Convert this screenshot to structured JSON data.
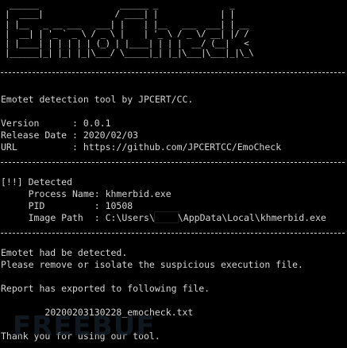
{
  "banner_ascii": "  ______                 ______ _               _\n |  ____|               / ____| |             | |\n | |__   _ __ ___   ___| |    | |__   ___  ___| | __\n |  __| | '_ ` _ \\ / _ \\ |    | '_ \\ / _ \\/ __| |/ /\n | |____| | | | | | (_) | |____| | | |  __/ (__|   <\n |______|_| |_| |_|\\___/ \\_____|_| |_|\\___|\\___|_|\\_\\",
  "intro": "Emotet detection tool by JPCERT/CC.",
  "version": {
    "label": "Version      ",
    "sep": ": ",
    "value": "0.0.1"
  },
  "release": {
    "label": "Release Date ",
    "sep": ": ",
    "value": "2020/02/03"
  },
  "url": {
    "label": "URL          ",
    "sep": ": ",
    "value": "https://github.com/JPCERTCC/EmoCheck"
  },
  "detected": {
    "header": "[!!] Detected",
    "process_label": "Process Name: ",
    "process_name": "khmerbid.exe",
    "pid_label": "PID         : ",
    "pid": "10508",
    "path_label": "Image Path  : ",
    "path_prefix": "C:\\Users\\",
    "path_suffix": "\\AppData\\Local\\khmerbid.exe"
  },
  "result_line1": "Emotet had be detected.",
  "result_line2": "Please remove or isolate the suspicious execution file.",
  "report_line": "Report has exported to following file.",
  "report_file": "20200203130228_emocheck.txt",
  "thanks": "Thank you for using our tool.",
  "colors": {
    "background": "#000000",
    "text": "#d4d4d4"
  },
  "watermark_text": "FREEBUF"
}
